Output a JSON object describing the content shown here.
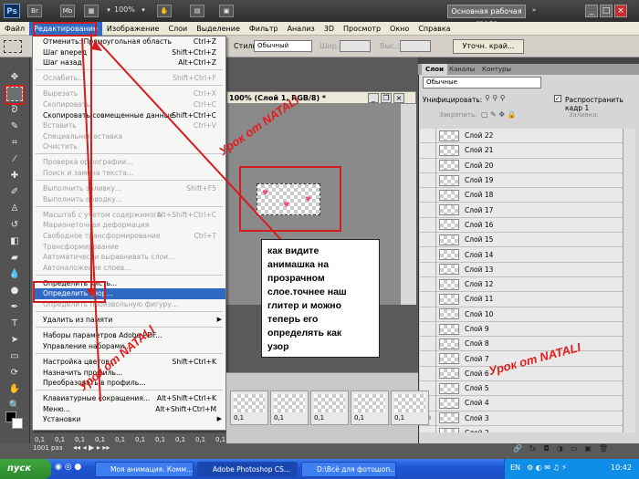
{
  "app": {
    "logo": "Ps",
    "zoom": "100%",
    "workspace": "Основная рабочая среда"
  },
  "menubar": [
    "Файл",
    "Редактирование",
    "Изображение",
    "Слои",
    "Выделение",
    "Фильтр",
    "Анализ",
    "3D",
    "Просмотр",
    "Окно",
    "Справка"
  ],
  "options": {
    "style_label": "Стиль:",
    "style_value": "Обычный",
    "width_label": "Шир.:",
    "height_label": "Выс.:",
    "refine_edge": "Уточн. край..."
  },
  "edit_menu": [
    {
      "label": "Отменить: Прямоугольная область",
      "shortcut": "Ctrl+Z",
      "enabled": true
    },
    {
      "label": "Шаг вперед",
      "shortcut": "Shift+Ctrl+Z",
      "enabled": true
    },
    {
      "label": "Шаг назад",
      "shortcut": "Alt+Ctrl+Z",
      "enabled": true
    },
    {
      "sep": true
    },
    {
      "label": "Ослабить...",
      "shortcut": "Shift+Ctrl+F",
      "enabled": false
    },
    {
      "sep": true
    },
    {
      "label": "Вырезать",
      "shortcut": "Ctrl+X",
      "enabled": false
    },
    {
      "label": "Скопировать",
      "shortcut": "Ctrl+C",
      "enabled": false
    },
    {
      "label": "Скопировать совмещенные данные",
      "shortcut": "Shift+Ctrl+C",
      "enabled": true
    },
    {
      "label": "Вставить",
      "shortcut": "Ctrl+V",
      "enabled": false
    },
    {
      "label": "Специальная вставка",
      "shortcut": "",
      "enabled": false
    },
    {
      "label": "Очистить",
      "shortcut": "",
      "enabled": false
    },
    {
      "sep": true
    },
    {
      "label": "Проверка орфографии...",
      "shortcut": "",
      "enabled": false
    },
    {
      "label": "Поиск и замена текста...",
      "shortcut": "",
      "enabled": false
    },
    {
      "sep": true
    },
    {
      "label": "Выполнить заливку...",
      "shortcut": "Shift+F5",
      "enabled": false
    },
    {
      "label": "Выполнить обводку...",
      "shortcut": "",
      "enabled": false
    },
    {
      "sep": true
    },
    {
      "label": "Масштаб с учетом содержимого",
      "shortcut": "Alt+Shift+Ctrl+C",
      "enabled": false
    },
    {
      "label": "Марионеточная деформация",
      "shortcut": "",
      "enabled": false
    },
    {
      "label": "Свободное трансформирование",
      "shortcut": "Ctrl+T",
      "enabled": false
    },
    {
      "label": "Трансформирование",
      "shortcut": "",
      "enabled": false
    },
    {
      "label": "Автоматически выравнивать слои...",
      "shortcut": "",
      "enabled": false
    },
    {
      "label": "Автоналожение слоев...",
      "shortcut": "",
      "enabled": false
    },
    {
      "sep": true
    },
    {
      "label": "Определить кисть...",
      "shortcut": "",
      "enabled": true
    },
    {
      "label": "Определить узор...",
      "shortcut": "",
      "enabled": true,
      "highlight": true
    },
    {
      "label": "Определить произвольную фигуру...",
      "shortcut": "",
      "enabled": false
    },
    {
      "sep": true
    },
    {
      "label": "Удалить из памяти",
      "shortcut": "",
      "enabled": true,
      "submenu": true
    },
    {
      "sep": true
    },
    {
      "label": "Наборы параметров Adobe PDF...",
      "shortcut": "",
      "enabled": true
    },
    {
      "label": "Управление наборами...",
      "shortcut": "",
      "enabled": true
    },
    {
      "sep": true
    },
    {
      "label": "Настройка цветов...",
      "shortcut": "Shift+Ctrl+K",
      "enabled": true
    },
    {
      "label": "Назначить профиль...",
      "shortcut": "",
      "enabled": true
    },
    {
      "label": "Преобразовать в профиль...",
      "shortcut": "",
      "enabled": true
    },
    {
      "sep": true
    },
    {
      "label": "Клавиатурные сокращения...",
      "shortcut": "Alt+Shift+Ctrl+K",
      "enabled": true
    },
    {
      "label": "Меню...",
      "shortcut": "Alt+Shift+Ctrl+M",
      "enabled": true
    },
    {
      "label": "Установки",
      "shortcut": "",
      "enabled": true,
      "submenu": true
    }
  ],
  "document": {
    "title": "100% (Слой 1, RGB/8) *"
  },
  "layers_panel": {
    "tabs": [
      "Слои",
      "Каналы",
      "Контуры"
    ],
    "blend_mode": "Обычные",
    "unify_label": "Унифицировать:",
    "propagate_label": "Распространить кадр 1",
    "lock_label": "Закрепить:",
    "fill_label": "Заливка:",
    "layers": [
      "Слой 22",
      "Слой 21",
      "Слой 20",
      "Слой 19",
      "Слой 18",
      "Слой 17",
      "Слой 16",
      "Слой 15",
      "Слой 14",
      "Слой 13",
      "Слой 12",
      "Слой 11",
      "Слой 10",
      "Слой 9",
      "Слой 8",
      "Слой 7",
      "Слой 6",
      "Слой 5",
      "Слой 4",
      "Слой 3",
      "Слой 2",
      "Слой 1"
    ],
    "selected_layer": "Слой 1",
    "visible_layer": "Слой 3",
    "footer_icons": [
      "link-icon",
      "fx-icon",
      "mask-icon",
      "adjustment-icon",
      "folder-icon",
      "new-layer-icon",
      "trash-icon"
    ]
  },
  "animation": {
    "frame_time": "0,1",
    "loop": "1001 раз"
  },
  "annotation": {
    "callout_lines": [
      "как видите",
      "анимашка на",
      "прозрачном",
      "слое.точнее наш",
      "глитер и можно",
      "теперь его",
      "определять как",
      "узор"
    ],
    "watermark": "Урок от NATALI"
  },
  "taskbar": {
    "start": "пуск",
    "tasks": [
      "Моя анимация. Комм...",
      "Adobe Photoshop CS...",
      "D:\\Всё для фотошоп..."
    ],
    "lang": "EN",
    "clock": "10:42"
  }
}
